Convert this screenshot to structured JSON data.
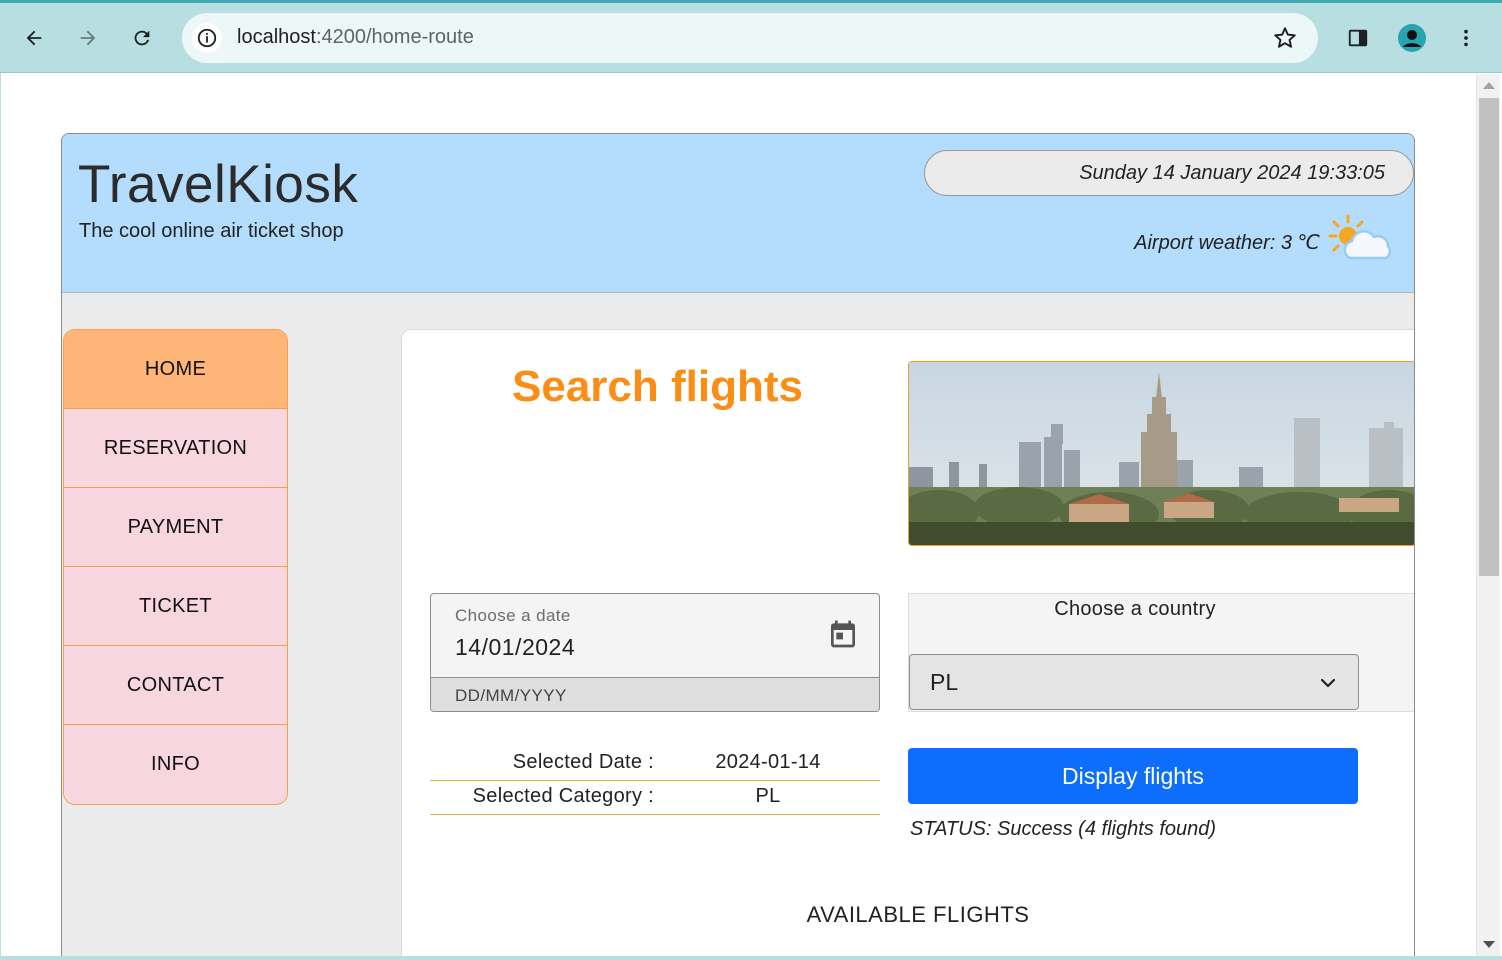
{
  "browser": {
    "url_host": "localhost",
    "url_rest": ":4200/home-route"
  },
  "header": {
    "brand": "TravelKiosk",
    "tagline": "The cool online air ticket shop",
    "datetime": "Sunday 14 January 2024 19:33:05",
    "weather": "Airport weather: 3 ℃",
    "weather_icon": "partly-cloudy-icon"
  },
  "sidebar": {
    "items": [
      {
        "label": "HOME",
        "active": true
      },
      {
        "label": "RESERVATION",
        "active": false
      },
      {
        "label": "PAYMENT",
        "active": false
      },
      {
        "label": "TICKET",
        "active": false
      },
      {
        "label": "CONTACT",
        "active": false
      },
      {
        "label": "INFO",
        "active": false
      }
    ]
  },
  "search": {
    "title": "Search flights",
    "date_label": "Choose a date",
    "date_value": "14/01/2024",
    "date_hint": "DD/MM/YYYY",
    "country_label": "Choose a country",
    "country_value": "PL",
    "button_label": "Display flights",
    "status": "STATUS: Success (4 flights found)"
  },
  "summary": {
    "date_label": "Selected Date :",
    "date_value": "2024-01-14",
    "category_label": "Selected Category :",
    "category_value": "PL"
  },
  "flights": {
    "heading": "AVAILABLE FLIGHTS"
  },
  "colors": {
    "accent_orange": "#fb8c14",
    "header_blue": "#b3dcfd",
    "button_blue": "#0d6efd",
    "sidebar_pink": "#f7d6e0",
    "sidebar_active": "#ffb577"
  }
}
